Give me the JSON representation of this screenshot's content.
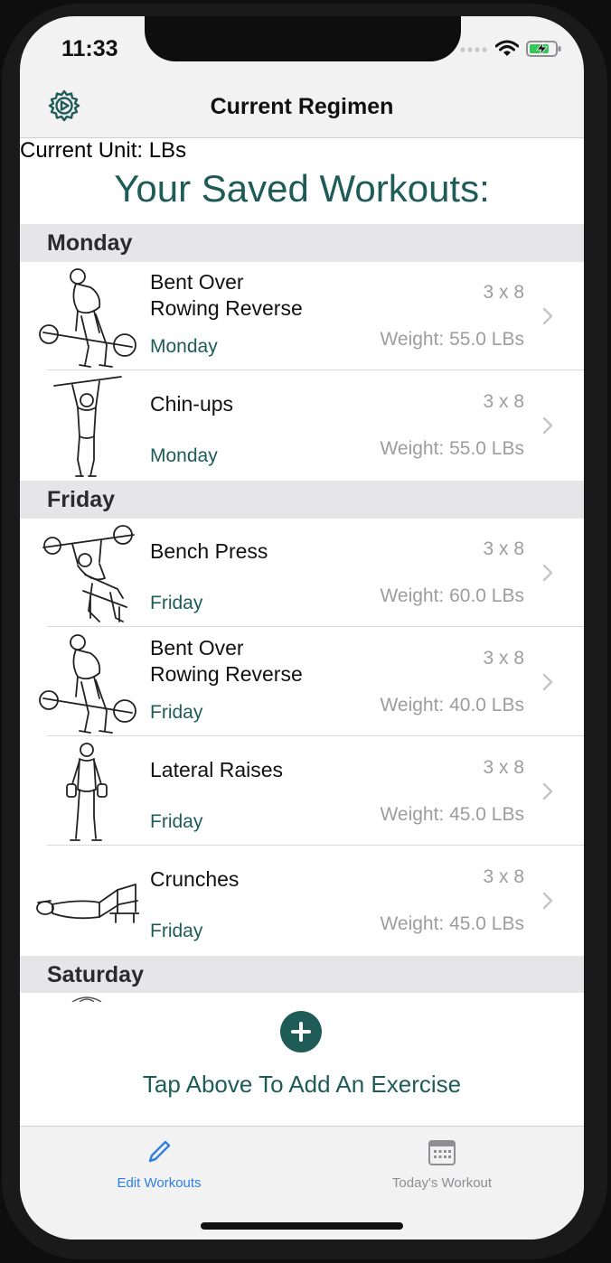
{
  "status_bar": {
    "time": "11:33"
  },
  "nav": {
    "title": "Current Regimen"
  },
  "header": {
    "unit_line": "Current Unit: LBs",
    "saved_title": "Your Saved Workouts:"
  },
  "sections": [
    {
      "day": "Monday",
      "rows": [
        {
          "name_line1": "Bent Over",
          "name_line2": "Rowing Reverse",
          "day": "Monday",
          "sets": "3 x 8",
          "weight": "Weight: 55.0 LBs",
          "icon": "bent-over-row-illustration"
        },
        {
          "name_line1": "Chin-ups",
          "name_line2": "",
          "day": "Monday",
          "sets": "3 x 8",
          "weight": "Weight: 55.0 LBs",
          "icon": "chin-up-illustration"
        }
      ]
    },
    {
      "day": "Friday",
      "rows": [
        {
          "name_line1": "Bench Press",
          "name_line2": "",
          "day": "Friday",
          "sets": "3 x 8",
          "weight": "Weight: 60.0 LBs",
          "icon": "bench-press-illustration"
        },
        {
          "name_line1": "Bent Over",
          "name_line2": "Rowing Reverse",
          "day": "Friday",
          "sets": "3 x 8",
          "weight": "Weight: 40.0 LBs",
          "icon": "bent-over-row-illustration"
        },
        {
          "name_line1": "Lateral Raises",
          "name_line2": "",
          "day": "Friday",
          "sets": "3 x 8",
          "weight": "Weight: 45.0 LBs",
          "icon": "lateral-raise-illustration"
        },
        {
          "name_line1": "Crunches",
          "name_line2": "",
          "day": "Friday",
          "sets": "3 x 8",
          "weight": "Weight: 45.0 LBs",
          "icon": "crunches-illustration"
        }
      ]
    },
    {
      "day": "Saturday",
      "rows": []
    }
  ],
  "add_exercise": {
    "label": "Tap Above To Add An Exercise"
  },
  "tabbar": {
    "tabs": [
      {
        "label": "Edit Workouts",
        "icon": "pencil-icon",
        "active": true
      },
      {
        "label": "Today's Workout",
        "icon": "calendar-icon",
        "active": false
      }
    ]
  },
  "colors": {
    "accent": "#1f5b57",
    "tab_active": "#2f7fe0",
    "tab_inactive": "#8e8e93",
    "secondary_text": "#9d9d9f"
  }
}
